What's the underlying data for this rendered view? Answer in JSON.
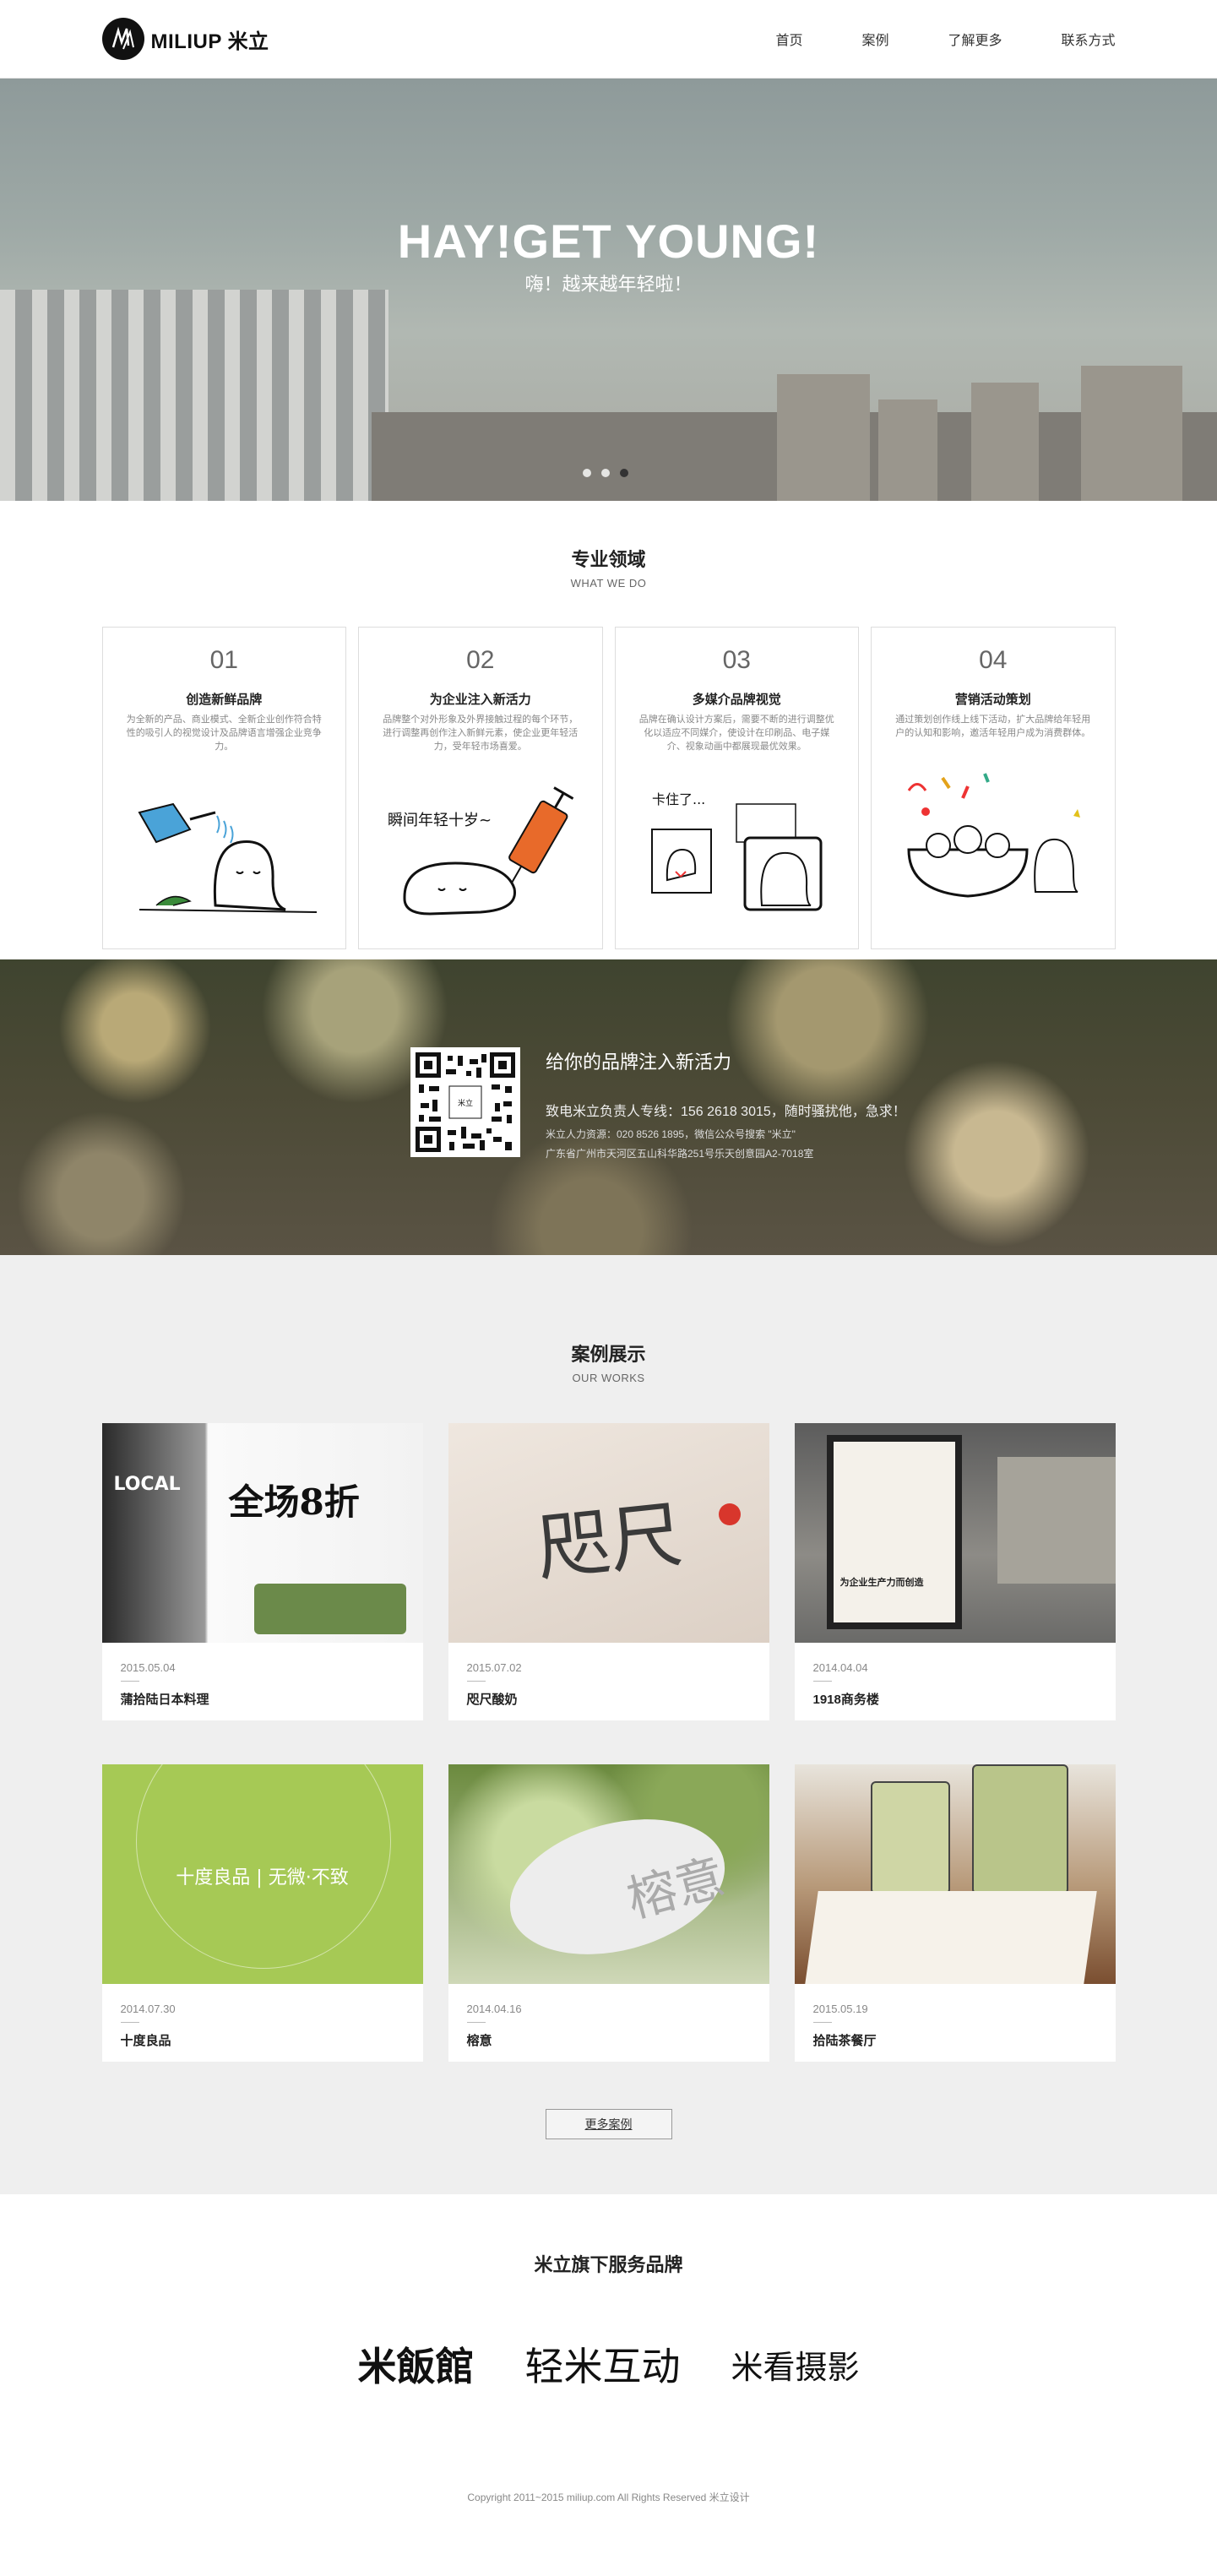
{
  "header": {
    "logo_text": "MILIUP 米立",
    "nav": [
      "首页",
      "案例",
      "了解更多",
      "联系方式"
    ]
  },
  "hero": {
    "title": "HAY!GET YOUNG!",
    "subtitle": "嗨！越来越年轻啦！",
    "slides": 3,
    "active_slide": 1
  },
  "services": {
    "title": "专业领域",
    "subtitle": "WHAT WE DO",
    "cards": [
      {
        "num": "01",
        "title": "创造新鲜品牌",
        "desc": "为全新的产品、商业模式、全新企业创作符合特性的吸引人的视觉设计及品牌语言增强企业竞争力。",
        "illustration": "watering-can-tooth-icon"
      },
      {
        "num": "02",
        "title": "为企业注入新活力",
        "desc": "品牌整个对外形象及外界接触过程的每个环节，进行调整再创作注入新鲜元素，使企业更年轻活力，受年轻市场喜爱。",
        "illustration": "syringe-tooth-icon",
        "illustration_text": "瞬间年轻十岁~"
      },
      {
        "num": "03",
        "title": "多媒介品牌视觉",
        "desc": "品牌在确认设计方案后，需要不断的进行调整优化以适应不同媒介，使设计在印刷品、电子媒介、视象动画中都展现最优效果。",
        "illustration": "tv-tooth-icon",
        "illustration_text": "卡住了..."
      },
      {
        "num": "04",
        "title": "营销活动策划",
        "desc": "通过策划创作线上线下活动，扩大品牌给年轻用户的认知和影响，邀活年轻用户成为消费群体。",
        "illustration": "party-tooth-icon"
      }
    ]
  },
  "band": {
    "title": "给你的品牌注入新活力",
    "line1": "致电米立负责人专线：156 2618 3015，随时骚扰他，急求！",
    "line2": "米立人力资源：020 8526 1895，微信公众号搜索 \"米立\"",
    "line3": "广东省广州市天河区五山科华路251号乐天创意园A2-7018室",
    "qr_label": "米立"
  },
  "works": {
    "title": "案例展示",
    "subtitle": "OUR WORKS",
    "items": [
      {
        "date": "2015.05.04",
        "name": "蒲拾陆日本料理",
        "thumb_text": "全场8折"
      },
      {
        "date": "2015.07.02",
        "name": "咫尺酸奶",
        "thumb_text": "咫尺"
      },
      {
        "date": "2014.04.04",
        "name": "1918商务楼",
        "thumb_text": "为企业生产力而创造"
      },
      {
        "date": "2014.07.30",
        "name": "十度良品",
        "thumb_text": "十度良品 | 无微·不致"
      },
      {
        "date": "2014.04.16",
        "name": "榕意",
        "thumb_text": "榕意"
      },
      {
        "date": "2015.05.19",
        "name": "拾陆茶餐厅",
        "thumb_text": ""
      }
    ],
    "more_label": "更多案例"
  },
  "brands": {
    "title": "米立旗下服务品牌",
    "logos": [
      "米飯館",
      "轻米互动",
      "米看摄影"
    ]
  },
  "footer": {
    "copyright": "Copyright 2011~2015 miliup.com All Rights Reserved 米立设计"
  },
  "colors": {
    "accent_green": "#a6c955",
    "works_bg": "#efefef"
  }
}
